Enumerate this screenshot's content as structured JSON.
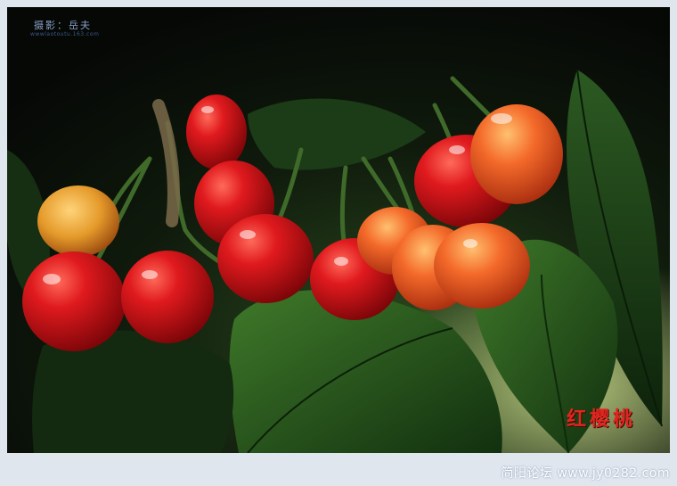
{
  "photo": {
    "credit": "摄影：岳夫",
    "credit_sub": "wwwlaotoutu.163.com",
    "caption": "红樱桃"
  },
  "footer": {
    "watermark": "简阳论坛 www.jy0282.com"
  },
  "colors": {
    "background": "#dfe6ee",
    "leaf": "#1f4a1c",
    "cherry_red": "#d3141b",
    "cherry_orange": "#f2692a",
    "caption": "#e0261f"
  }
}
